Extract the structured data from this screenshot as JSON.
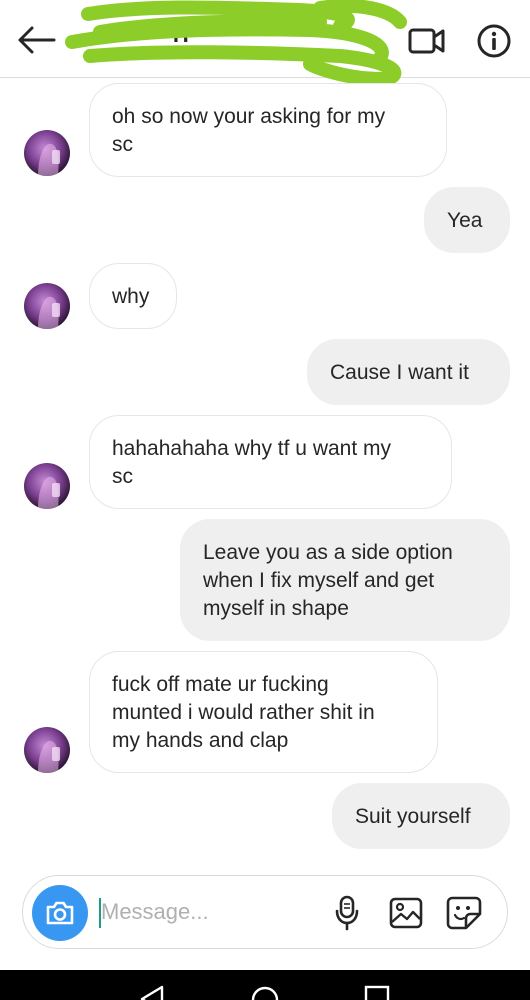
{
  "header": {
    "title": "• • • • • • H",
    "back_icon": "arrow-left-icon",
    "video_icon": "video-camera-icon",
    "info_icon": "info-circle-icon",
    "redaction_color": "#8ccd2a"
  },
  "messages": [
    {
      "direction": "received",
      "text": "oh so now your asking for my\nsc"
    },
    {
      "direction": "sent",
      "text": "Yea"
    },
    {
      "direction": "received",
      "text": "why"
    },
    {
      "direction": "sent",
      "text": "Cause I want it"
    },
    {
      "direction": "received",
      "text": "hahahahaha why tf u want my\nsc"
    },
    {
      "direction": "sent",
      "text": "Leave you as a side option\nwhen I fix myself and get\nmyself in shape"
    },
    {
      "direction": "received",
      "text": "fuck off mate ur fucking\nmunted i would rather shit in\nmy hands and clap"
    },
    {
      "direction": "sent",
      "text": "Suit yourself"
    }
  ],
  "composer": {
    "placeholder": "Message...",
    "value": "",
    "camera_icon": "camera-icon",
    "mic_icon": "microphone-icon",
    "gallery_icon": "image-gallery-icon",
    "sticker_icon": "sticker-icon",
    "accent_color": "#3897f0"
  },
  "navbar": {
    "back_icon": "nav-back-icon",
    "home_icon": "nav-home-icon",
    "recents_icon": "nav-recents-icon"
  }
}
